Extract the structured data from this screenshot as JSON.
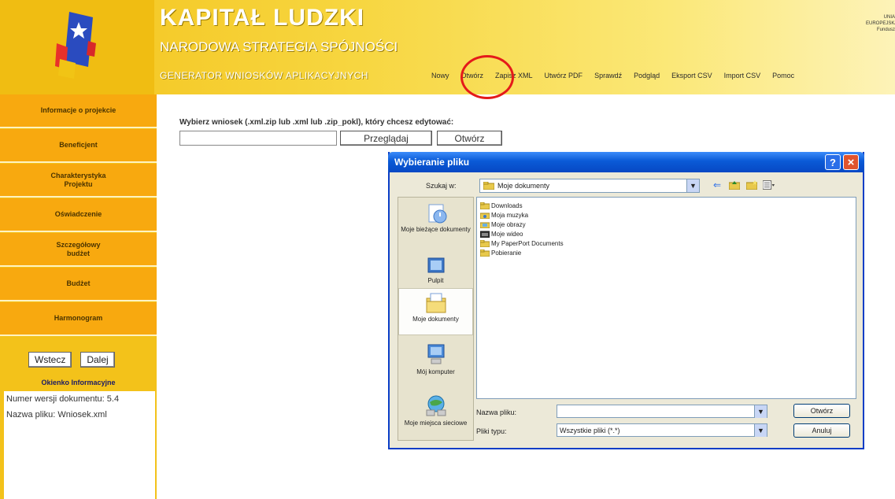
{
  "header": {
    "title": "KAPITAŁ LUDZKI",
    "subtitle": "NARODOWA STRATEGIA SPÓJNOŚCI",
    "generator": "GENERATOR WNIOSKÓW APLIKACYJNYCH",
    "eu_text": "UNIA EUROPEJSKA Fundusz",
    "menu": [
      "Nowy",
      "Otwórz",
      "Zapisz XML",
      "Utwórz PDF",
      "Sprawdź",
      "Podgląd",
      "Eksport CSV",
      "Import CSV",
      "Pomoc"
    ]
  },
  "sidebar": {
    "items": [
      {
        "label": "Informacje o projekcie"
      },
      {
        "label": "Beneficjent"
      },
      {
        "label": "Charakterystyka Projektu"
      },
      {
        "label": "Oświadczenie"
      },
      {
        "label": "Szczegółowy budżet"
      },
      {
        "label": "Budżet"
      },
      {
        "label": "Harmonogram"
      }
    ],
    "back_label": "Wstecz",
    "next_label": "Dalej",
    "info_title": "Okienko Informacyjne",
    "info_lines": [
      "Numer wersji dokumentu: 5.4",
      "Nazwa pliku: Wniosek.xml"
    ]
  },
  "main": {
    "prompt": "Wybierz wniosek (.xml.zip lub .xml lub .zip_pokl), który chcesz edytować:",
    "file_value": "",
    "browse_label": "Przeglądaj",
    "open_label": "Otwórz"
  },
  "dialog": {
    "title": "Wybieranie pliku",
    "help_label": "?",
    "close_label": "×",
    "lookin_label": "Szukaj w:",
    "lookin_value": "Moje dokumenty",
    "places": [
      "Moje bieżące dokumenty",
      "Pulpit",
      "Moje dokumenty",
      "Mój komputer",
      "Moje miejsca sieciowe"
    ],
    "files": [
      "Downloads",
      "Moja muzyka",
      "Moje obrazy",
      "Moje wideo",
      "My PaperPort Documents",
      "Pobieranie"
    ],
    "filename_label": "Nazwa pliku:",
    "filename_value": "",
    "filetype_label": "Pliki typu:",
    "filetype_value": "Wszystkie pliki (*.*)",
    "open_label": "Otwórz",
    "cancel_label": "Anuluj"
  },
  "colors": {
    "sidebar_button": "#f8a90f",
    "header_yellow": "#f3c21a",
    "highlight_circle": "#e41a1a",
    "dialog_title": "#0a5ad6"
  }
}
